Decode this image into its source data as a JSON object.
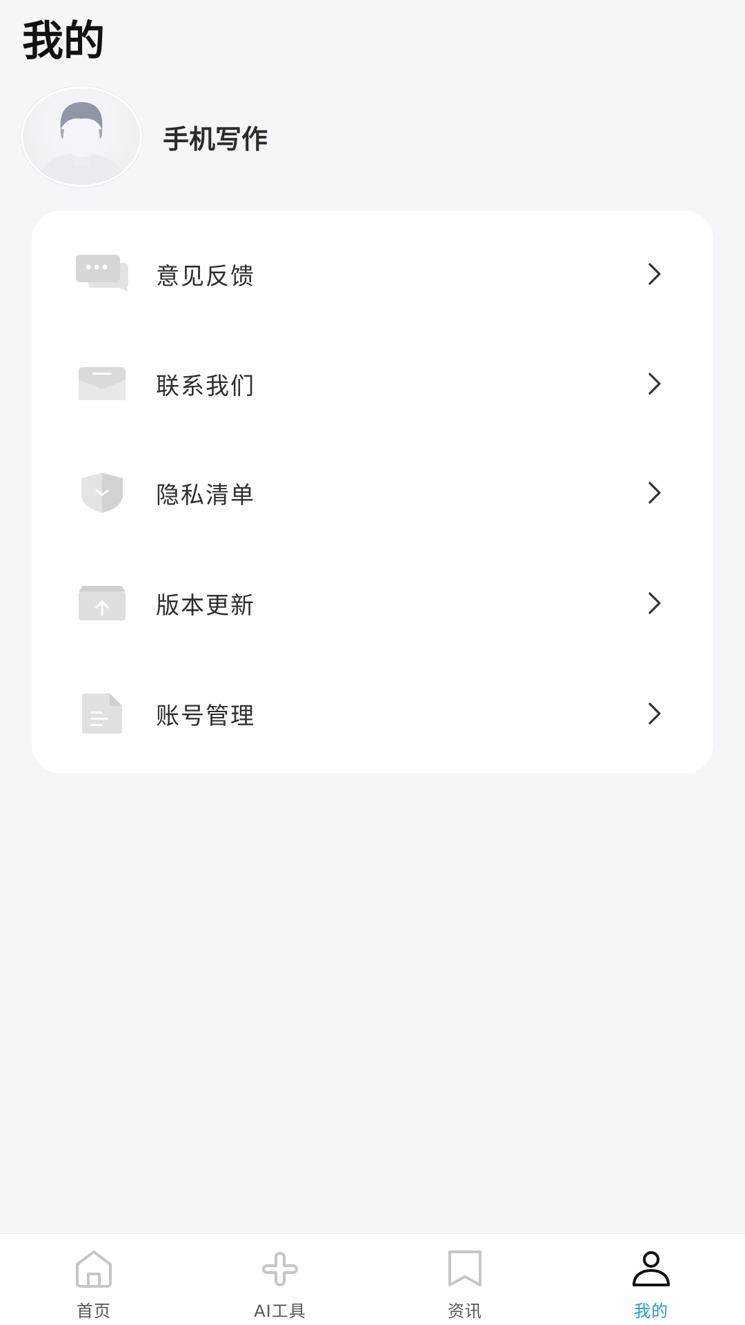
{
  "header": {
    "title": "我的"
  },
  "profile": {
    "avatar_icon": "default-avatar-icon",
    "username": "手机写作"
  },
  "menu": {
    "items": [
      {
        "label": "意见反馈",
        "icon": "feedback-icon"
      },
      {
        "label": "联系我们",
        "icon": "mail-icon"
      },
      {
        "label": "隐私清单",
        "icon": "shield-icon"
      },
      {
        "label": "版本更新",
        "icon": "upload-box-icon"
      },
      {
        "label": "账号管理",
        "icon": "document-icon"
      }
    ],
    "arrow_icon": "chevron-right-icon"
  },
  "tabbar": {
    "tabs": [
      {
        "label": "首页",
        "icon": "home-icon",
        "active": false
      },
      {
        "label": "AI工具",
        "icon": "tools-icon",
        "active": false
      },
      {
        "label": "资讯",
        "icon": "news-icon",
        "active": false
      },
      {
        "label": "我的",
        "icon": "user-icon",
        "active": true
      }
    ]
  },
  "colors": {
    "background": "#f5f6fa",
    "card": "#ffffff",
    "icon_gray": "#d9d9d9",
    "active_tab": "#1ea0c8",
    "text_primary": "#2e2e2e"
  }
}
